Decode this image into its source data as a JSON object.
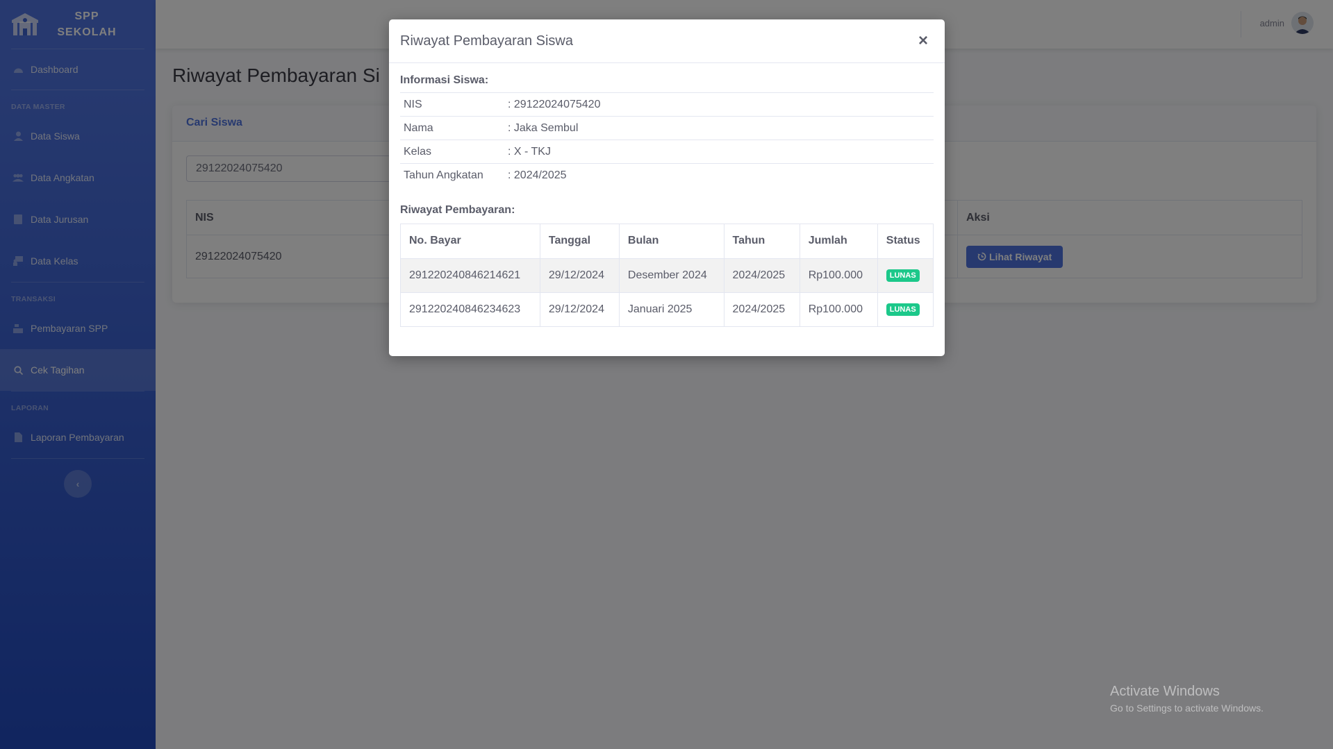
{
  "brand": {
    "line1": "SPP",
    "line2": "SEKOLAH"
  },
  "sidebar": {
    "dashboard": "Dashboard",
    "heading_master": "DATA MASTER",
    "master_items": [
      "Data Siswa",
      "Data Angkatan",
      "Data Jurusan",
      "Data Kelas"
    ],
    "heading_transaksi": "TRANSAKSI",
    "transaksi_items": [
      "Pembayaran SPP",
      "Cek Tagihan"
    ],
    "heading_laporan": "LAPORAN",
    "laporan_items": [
      "Laporan Pembayaran"
    ],
    "toggle": "‹"
  },
  "topbar": {
    "user": "admin"
  },
  "page": {
    "title": "Riwayat Pembayaran Si",
    "card_title": "Cari Siswa",
    "search_value": "29122024075420",
    "table_headers": [
      "NIS",
      "Aksi"
    ],
    "table_row": {
      "nis": "29122024075420",
      "action": "Lihat Riwayat"
    }
  },
  "modal": {
    "title": "Riwayat Pembayaran Siswa",
    "close": "×",
    "info_label": "Informasi Siswa:",
    "info": [
      {
        "key": "NIS",
        "value": ": 29122024075420"
      },
      {
        "key": "Nama",
        "value": ": Jaka Sembul"
      },
      {
        "key": "Kelas",
        "value": ": X - TKJ"
      },
      {
        "key": "Tahun Angkatan",
        "value": ": 2024/2025"
      }
    ],
    "history_label": "Riwayat Pembayaran:",
    "headers": [
      "No. Bayar",
      "Tanggal",
      "Bulan",
      "Tahun",
      "Jumlah",
      "Status"
    ],
    "rows": [
      [
        "291220240846214621",
        "29/12/2024",
        "Desember 2024",
        "2024/2025",
        "Rp100.000",
        "LUNAS"
      ],
      [
        "291220240846234623",
        "29/12/2024",
        "Januari 2025",
        "2024/2025",
        "Rp100.000",
        "LUNAS"
      ]
    ]
  },
  "watermark": {
    "line1": "Activate Windows",
    "line2": "Go to Settings to activate Windows."
  },
  "colors": {
    "primary": "#4e73df",
    "success": "#1cc88a",
    "sidebar_dark": "#224abe"
  }
}
